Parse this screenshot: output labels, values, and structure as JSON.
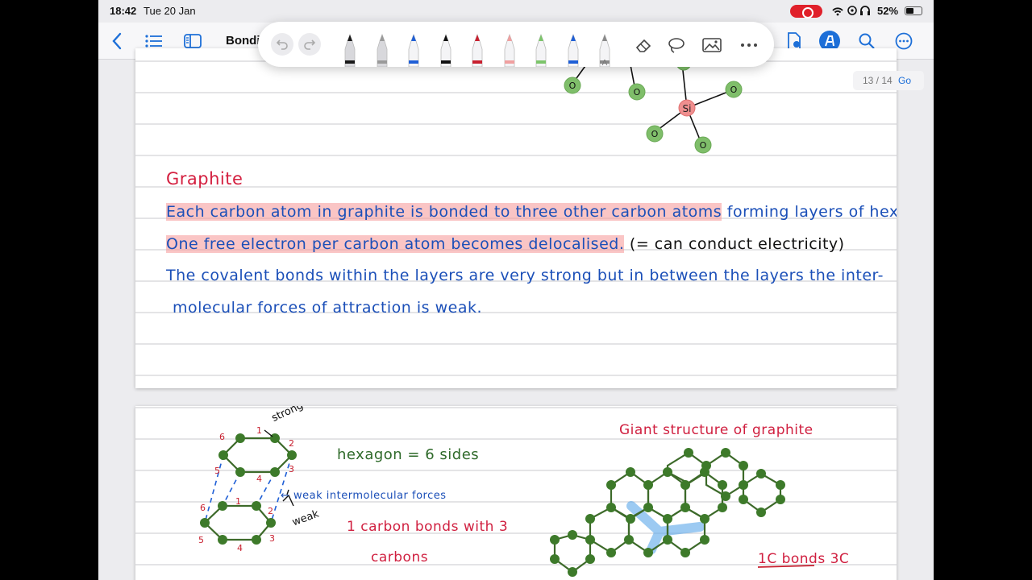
{
  "status_bar": {
    "time": "18:42",
    "date": "Tue 20 Jan",
    "battery": "52%",
    "battery_level": 0.52
  },
  "nav": {
    "title": "Bondi"
  },
  "toolbar": {
    "pens": [
      {
        "name": "fountain-pen-black",
        "color": "#1a1a1a"
      },
      {
        "name": "fountain-pen-gray",
        "color": "#9a9a9a"
      },
      {
        "name": "ballpoint-blue",
        "color": "#1f5fd6"
      },
      {
        "name": "ballpoint-black",
        "color": "#111111"
      },
      {
        "name": "fineliner-red",
        "color": "#c8202f"
      },
      {
        "name": "highlighter-pink",
        "color": "#f0a0a0"
      },
      {
        "name": "highlighter-green",
        "color": "#7cc46a"
      },
      {
        "name": "brush-blue",
        "color": "#1f5fd6"
      },
      {
        "name": "pencil-gray",
        "color": "#8a8a8a",
        "label": "A"
      }
    ]
  },
  "page_indicator": {
    "text": "13 / 14",
    "go_label": "Go"
  },
  "page13": {
    "si_label": "Si",
    "o_label": "O",
    "heading": "Graphite",
    "line1_highlighted": "Each carbon atom in graphite is bonded to three other carbon atoms",
    "line1_rest": " forming layers of hexagons.",
    "line2_highlighted": "One free electron per carbon atom becomes delocalised.",
    "line2_note": " (= can conduct electricity)",
    "line3": "The covalent bonds within the layers are very strong but in between the layers the inter-",
    "line4": "molecular forces of attraction is weak."
  },
  "page14": {
    "strong_label": "strong",
    "weak_label": "weak",
    "hexagon_note": "hexagon = 6 sides",
    "weak_forces_note": "weak intermolecular forces",
    "bonds_note_1": "1 carbon bonds with 3",
    "bonds_note_2": "carbons",
    "giant_title": "Giant structure of graphite",
    "bonds_3c": "1C bonds 3C",
    "top_hex_numbers": [
      "6",
      "1",
      "2",
      "3",
      "4",
      "5"
    ],
    "bottom_hex_numbers": [
      "6",
      "1",
      "2",
      "3",
      "4",
      "5"
    ]
  },
  "colors": {
    "accent": "#1d6fd8",
    "heading_red": "#d42040",
    "ink_blue": "#1b4fb8",
    "atom_green": "#3d7a2a",
    "highlight": "#f6a0a0"
  }
}
